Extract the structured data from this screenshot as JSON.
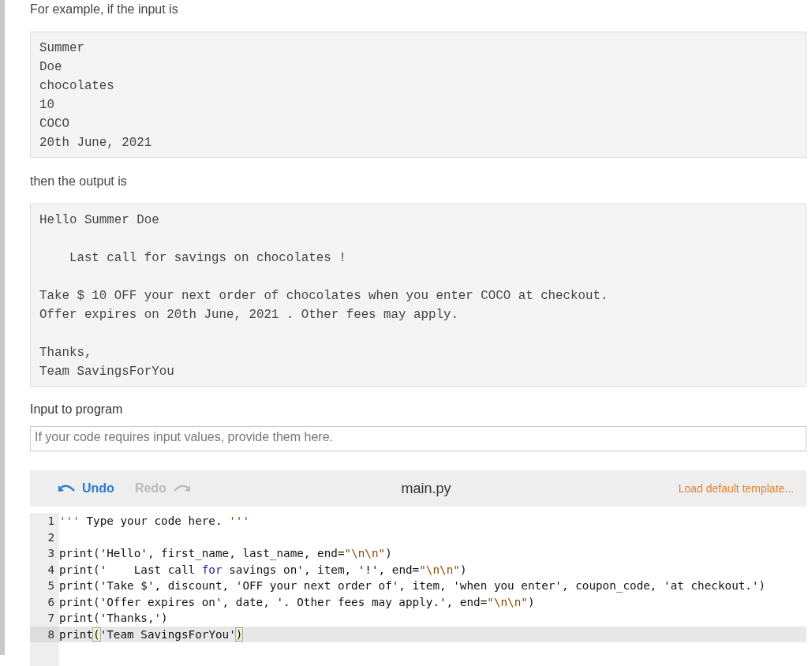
{
  "intro": "For example, if the input is",
  "example_input": [
    "Summer",
    "Doe",
    "chocolates",
    "10",
    "COCO",
    "20th June, 2021"
  ],
  "output_intro": "then the output is",
  "example_output": [
    [
      "Hello Summer Doe"
    ],
    [
      "    Last call for savings on chocolates !"
    ],
    [
      "Take $ 10 OFF your next order of chocolates when you enter COCO at checkout.",
      "Offer expires on 20th June, 2021 . Other fees may apply."
    ],
    [
      "Thanks,",
      "Team SavingsForYou"
    ]
  ],
  "input_label": "Input to program",
  "input_field": {
    "placeholder": "If your code requires input values, provide them here."
  },
  "editor": {
    "undo": {
      "label": "Undo",
      "disabled": false
    },
    "redo": {
      "label": "Redo",
      "disabled": true
    },
    "filename": "main.py",
    "load_template": "Load default template...",
    "lines": [
      {
        "number": "1",
        "active": false,
        "tokens": [
          {
            "kind": "accent",
            "text": "'''"
          },
          {
            "kind": "plain",
            "text": " Type your code here. "
          },
          {
            "kind": "accent",
            "text": "'''"
          }
        ]
      },
      {
        "number": "2",
        "active": false
      },
      {
        "number": "3",
        "active": false,
        "tokens": [
          {
            "kind": "plain",
            "text": "print('Hello', first_name, last_name, end="
          },
          {
            "kind": "accent",
            "text": "\"\\n\\n\""
          },
          {
            "kind": "plain",
            "text": ")"
          }
        ]
      },
      {
        "number": "4",
        "active": false,
        "tokens": [
          {
            "kind": "plain",
            "text": "print('    Last call "
          },
          {
            "kind": "keyword",
            "text": "for"
          },
          {
            "kind": "plain",
            "text": " savings on', item, '!', end="
          },
          {
            "kind": "accent",
            "text": "\"\\n\\n\""
          },
          {
            "kind": "plain",
            "text": ")"
          }
        ]
      },
      {
        "number": "5",
        "active": false,
        "tokens": [
          {
            "kind": "plain",
            "text": "print('Take $', discount, 'OFF your next order of', item, 'when you enter', coupon_code, 'at checkout.')"
          }
        ]
      },
      {
        "number": "6",
        "active": false,
        "tokens": [
          {
            "kind": "plain",
            "text": "print('Offer expires on', date, '. Other fees may apply.', end="
          },
          {
            "kind": "accent",
            "text": "\"\\n\\n\""
          },
          {
            "kind": "plain",
            "text": ")"
          }
        ]
      },
      {
        "number": "7",
        "active": false,
        "tokens": [
          {
            "kind": "plain",
            "text": "print('Thanks,')"
          }
        ]
      },
      {
        "number": "8",
        "active": true,
        "tokens": [
          {
            "kind": "plain",
            "text": "print"
          },
          {
            "kind": "bracket",
            "text": "("
          },
          {
            "kind": "plain",
            "text": "'Team SavingsForYou'"
          },
          {
            "kind": "bracket",
            "text": ")"
          }
        ]
      }
    ]
  }
}
